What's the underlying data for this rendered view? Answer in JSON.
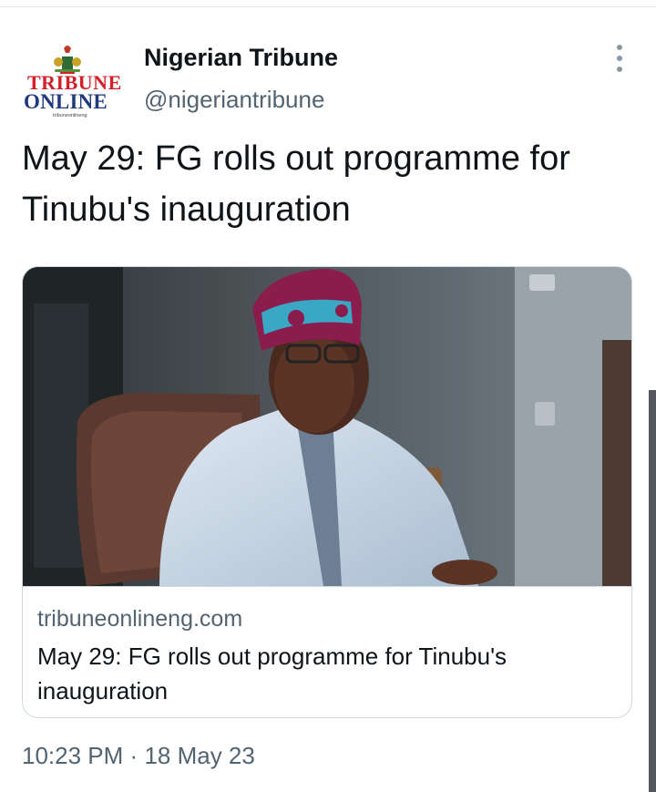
{
  "author": {
    "name": "Nigerian Tribune",
    "handle": "@nigeriantribune",
    "logo": {
      "line1": "TRIBUNE",
      "line2": "ONLINE",
      "small": "tribuneonlineng"
    }
  },
  "tweet": {
    "text": "May 29: FG rolls out programme for Tinubu's inauguration"
  },
  "card": {
    "domain": "tribuneonlineng.com",
    "title": "May 29: FG rolls out programme for Tinubu's inauguration"
  },
  "meta": {
    "time": "10:23 PM",
    "separator": "·",
    "date": "18 May 23"
  },
  "icons": {
    "more": "more-options-icon"
  },
  "colors": {
    "text": "#0f1419",
    "secondary": "#536471",
    "border": "#cfd9de",
    "logo_red": "#d3202a",
    "logo_blue": "#203a7d"
  }
}
